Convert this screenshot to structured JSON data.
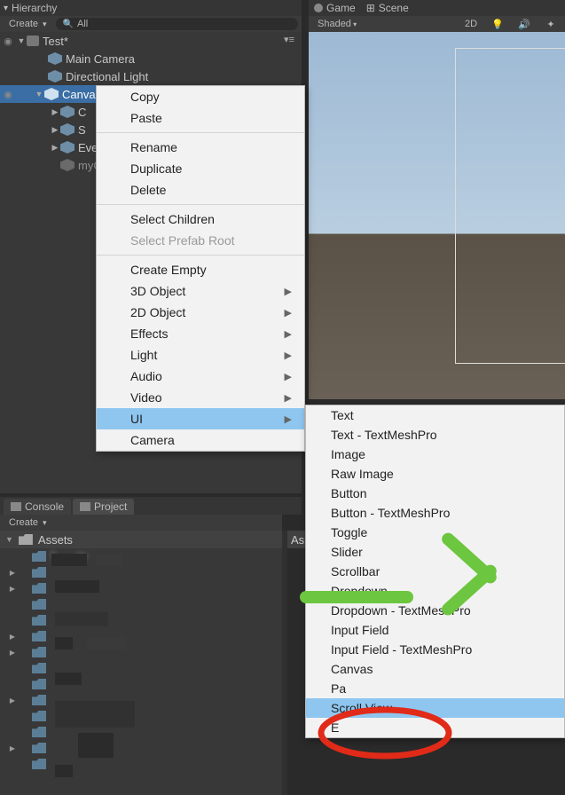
{
  "hierarchy": {
    "panel_title_prefix": "▾",
    "panel_title": "Hierarchy",
    "create_label": "Create",
    "search_placeholder": "All",
    "root": "Test*",
    "items": {
      "main_camera": "Main Camera",
      "dir_light": "Directional Light",
      "canvas": "Canvas",
      "child_c": "C",
      "child_s": "S",
      "eve": "Eve",
      "myc": "myC"
    }
  },
  "scene": {
    "tab_game": "Game",
    "tab_scene": "Scene",
    "shaded": "Shaded",
    "btn_2d": "2D",
    "bulb": "💡",
    "sound": "🔊"
  },
  "bottom": {
    "tab_console": "Console",
    "tab_project": "Project",
    "create_label": "Create",
    "assets": "Assets",
    "assets_right": "As"
  },
  "ctx1": {
    "copy": "Copy",
    "paste": "Paste",
    "rename": "Rename",
    "duplicate": "Duplicate",
    "delete": "Delete",
    "select_children": "Select Children",
    "select_prefab_root": "Select Prefab Root",
    "create_empty": "Create Empty",
    "obj3d": "3D Object",
    "obj2d": "2D Object",
    "effects": "Effects",
    "light": "Light",
    "audio": "Audio",
    "video": "Video",
    "ui": "UI",
    "camera": "Camera"
  },
  "ctx2": {
    "text": "Text",
    "text_tmp": "Text - TextMeshPro",
    "image": "Image",
    "raw_image": "Raw Image",
    "button": "Button",
    "button_tmp": "Button - TextMeshPro",
    "toggle": "Toggle",
    "slider": "Slider",
    "scrollbar": "Scrollbar",
    "dropdown": "Dropdown",
    "dropdown_tmp": "Dropdown - TextMeshPro",
    "input_field": "Input Field",
    "input_field_tmp": "Input Field - TextMeshPro",
    "canvas": "Canvas",
    "panel": "Pa",
    "scroll_view": "Scroll View",
    "event_system": "E"
  },
  "colors": {
    "selection": "#3a6ea5",
    "menu_highlight": "#8ec6f0",
    "annotation_green": "#6dc63f",
    "annotation_red": "#e12a18"
  }
}
